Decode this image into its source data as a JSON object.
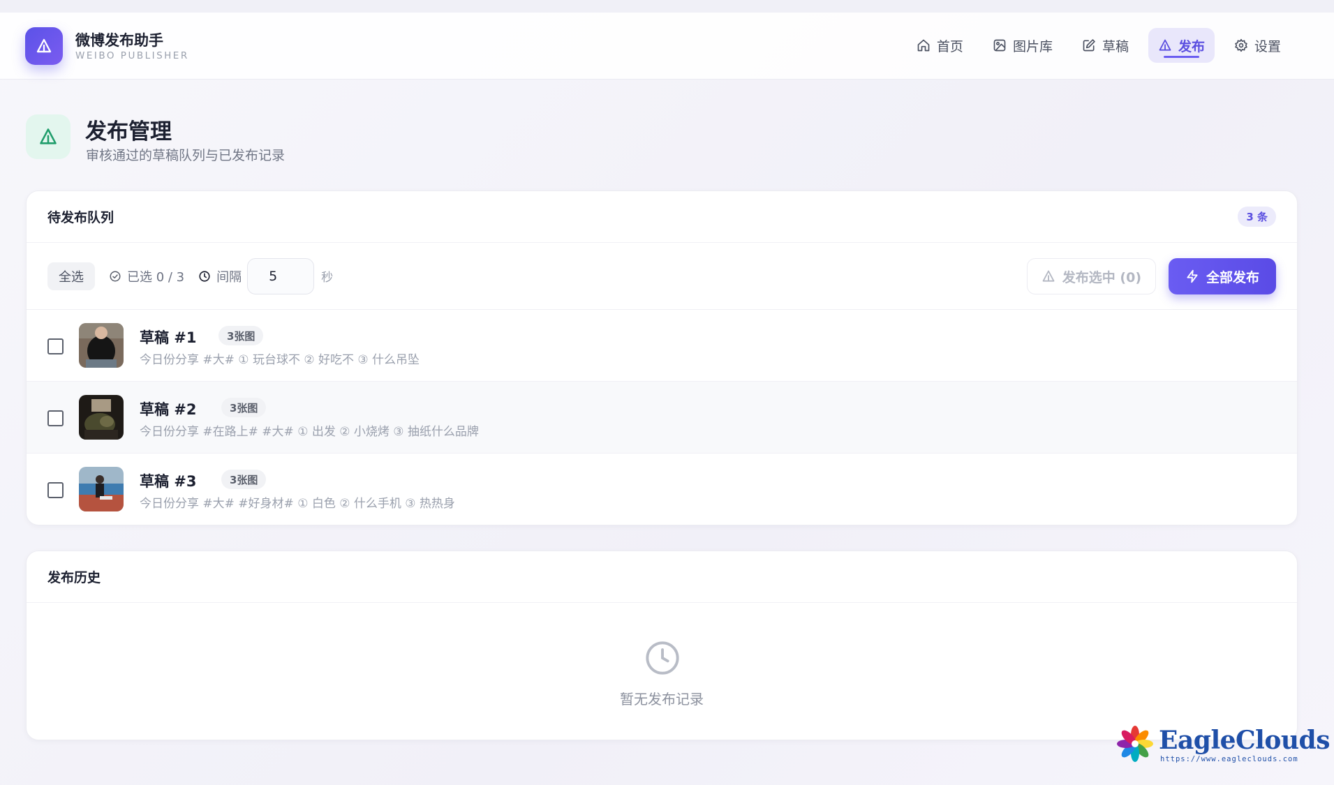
{
  "app": {
    "title": "微博发布助手",
    "subtitle": "WEIBO PUBLISHER"
  },
  "nav": [
    {
      "label": "首页",
      "icon": "home-icon",
      "active": false
    },
    {
      "label": "图片库",
      "icon": "image-icon",
      "active": false
    },
    {
      "label": "草稿",
      "icon": "edit-icon",
      "active": false
    },
    {
      "label": "发布",
      "icon": "send-icon",
      "active": true
    },
    {
      "label": "设置",
      "icon": "gear-icon",
      "active": false
    }
  ],
  "page": {
    "title": "发布管理",
    "subtitle": "审核通过的草稿队列与已发布记录"
  },
  "queue": {
    "title": "待发布队列",
    "count": "3 条",
    "select_all": "全选",
    "selected": "已选 0 / 3",
    "interval_label": "间隔",
    "interval_value": "5",
    "interval_unit": "秒",
    "publish_selected": "发布选中 (0)",
    "publish_all": "全部发布",
    "items": [
      {
        "title": "草稿 #1",
        "badge": "3张图",
        "desc": "今日份分享 #大# ① 玩台球不 ② 好吃不 ③ 什么吊坠",
        "checked": false
      },
      {
        "title": "草稿 #2",
        "badge": "3张图",
        "desc": "今日份分享 #在路上# #大# ① 出发 ② 小烧烤 ③ 抽纸什么品牌",
        "checked": false
      },
      {
        "title": "草稿 #3",
        "badge": "3张图",
        "desc": "今日份分享 #大# #好身材# ① 白色 ② 什么手机 ③ 热热身",
        "checked": false
      }
    ]
  },
  "history": {
    "title": "发布历史",
    "empty_text": "暂无发布记录"
  },
  "watermark": {
    "brand": "EagleClouds",
    "url": "https://www.eagleclouds.com"
  },
  "colors": {
    "accent": "#5b4fe0",
    "accent_bg": "#e9e7fb",
    "page_icon_bg": "#e3f6ee",
    "page_icon": "#1f9d6b"
  }
}
